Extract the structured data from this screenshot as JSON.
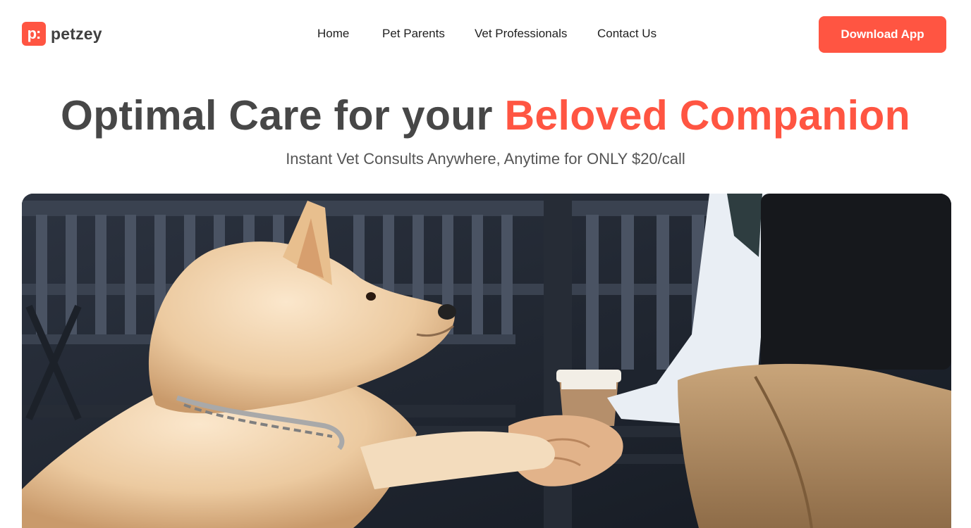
{
  "brand": {
    "mark": "p:",
    "name": "petzey",
    "accent_color": "#ff5542"
  },
  "nav": {
    "items": [
      {
        "label": "Home"
      },
      {
        "label": "Pet Parents"
      },
      {
        "label": "Vet Professionals"
      },
      {
        "label": "Contact Us"
      }
    ]
  },
  "header": {
    "cta_label": "Download App"
  },
  "hero": {
    "title_prefix": "Optimal Care for your ",
    "title_accent": "Beloved Companion",
    "subtitle": "Instant Vet Consults Anywhere, Anytime for ONLY $20/call",
    "image": "photo of a shiba inu dog shaking hands with a person on a bench"
  }
}
